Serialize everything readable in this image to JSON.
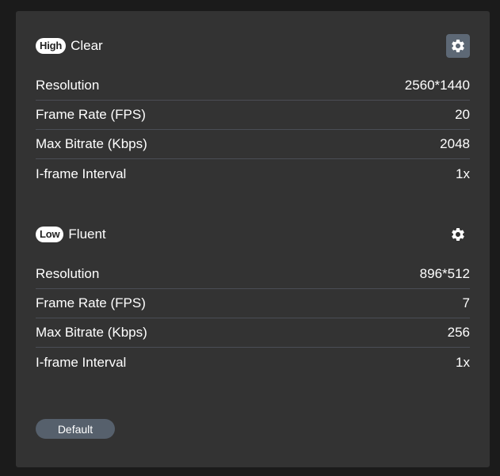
{
  "high_stream": {
    "badge": "High",
    "title": "Clear",
    "settings_icon": "gear-icon",
    "rows": [
      {
        "label": "Resolution",
        "value": "2560*1440"
      },
      {
        "label": "Frame Rate (FPS)",
        "value": "20"
      },
      {
        "label": "Max Bitrate (Kbps)",
        "value": "2048"
      },
      {
        "label": "I-frame Interval",
        "value": "1x"
      }
    ]
  },
  "low_stream": {
    "badge": "Low",
    "title": "Fluent",
    "settings_icon": "gear-icon",
    "rows": [
      {
        "label": "Resolution",
        "value": "896*512"
      },
      {
        "label": "Frame Rate (FPS)",
        "value": "7"
      },
      {
        "label": "Max Bitrate (Kbps)",
        "value": "256"
      },
      {
        "label": "I-frame Interval",
        "value": "1x"
      }
    ]
  },
  "default_button": {
    "label": "Default"
  },
  "colors": {
    "panel_background": "#333333",
    "page_background": "#1b1b1b",
    "active_settings_button": "#5d6875",
    "default_button": "#56606c",
    "divider": "#4a4d55"
  }
}
